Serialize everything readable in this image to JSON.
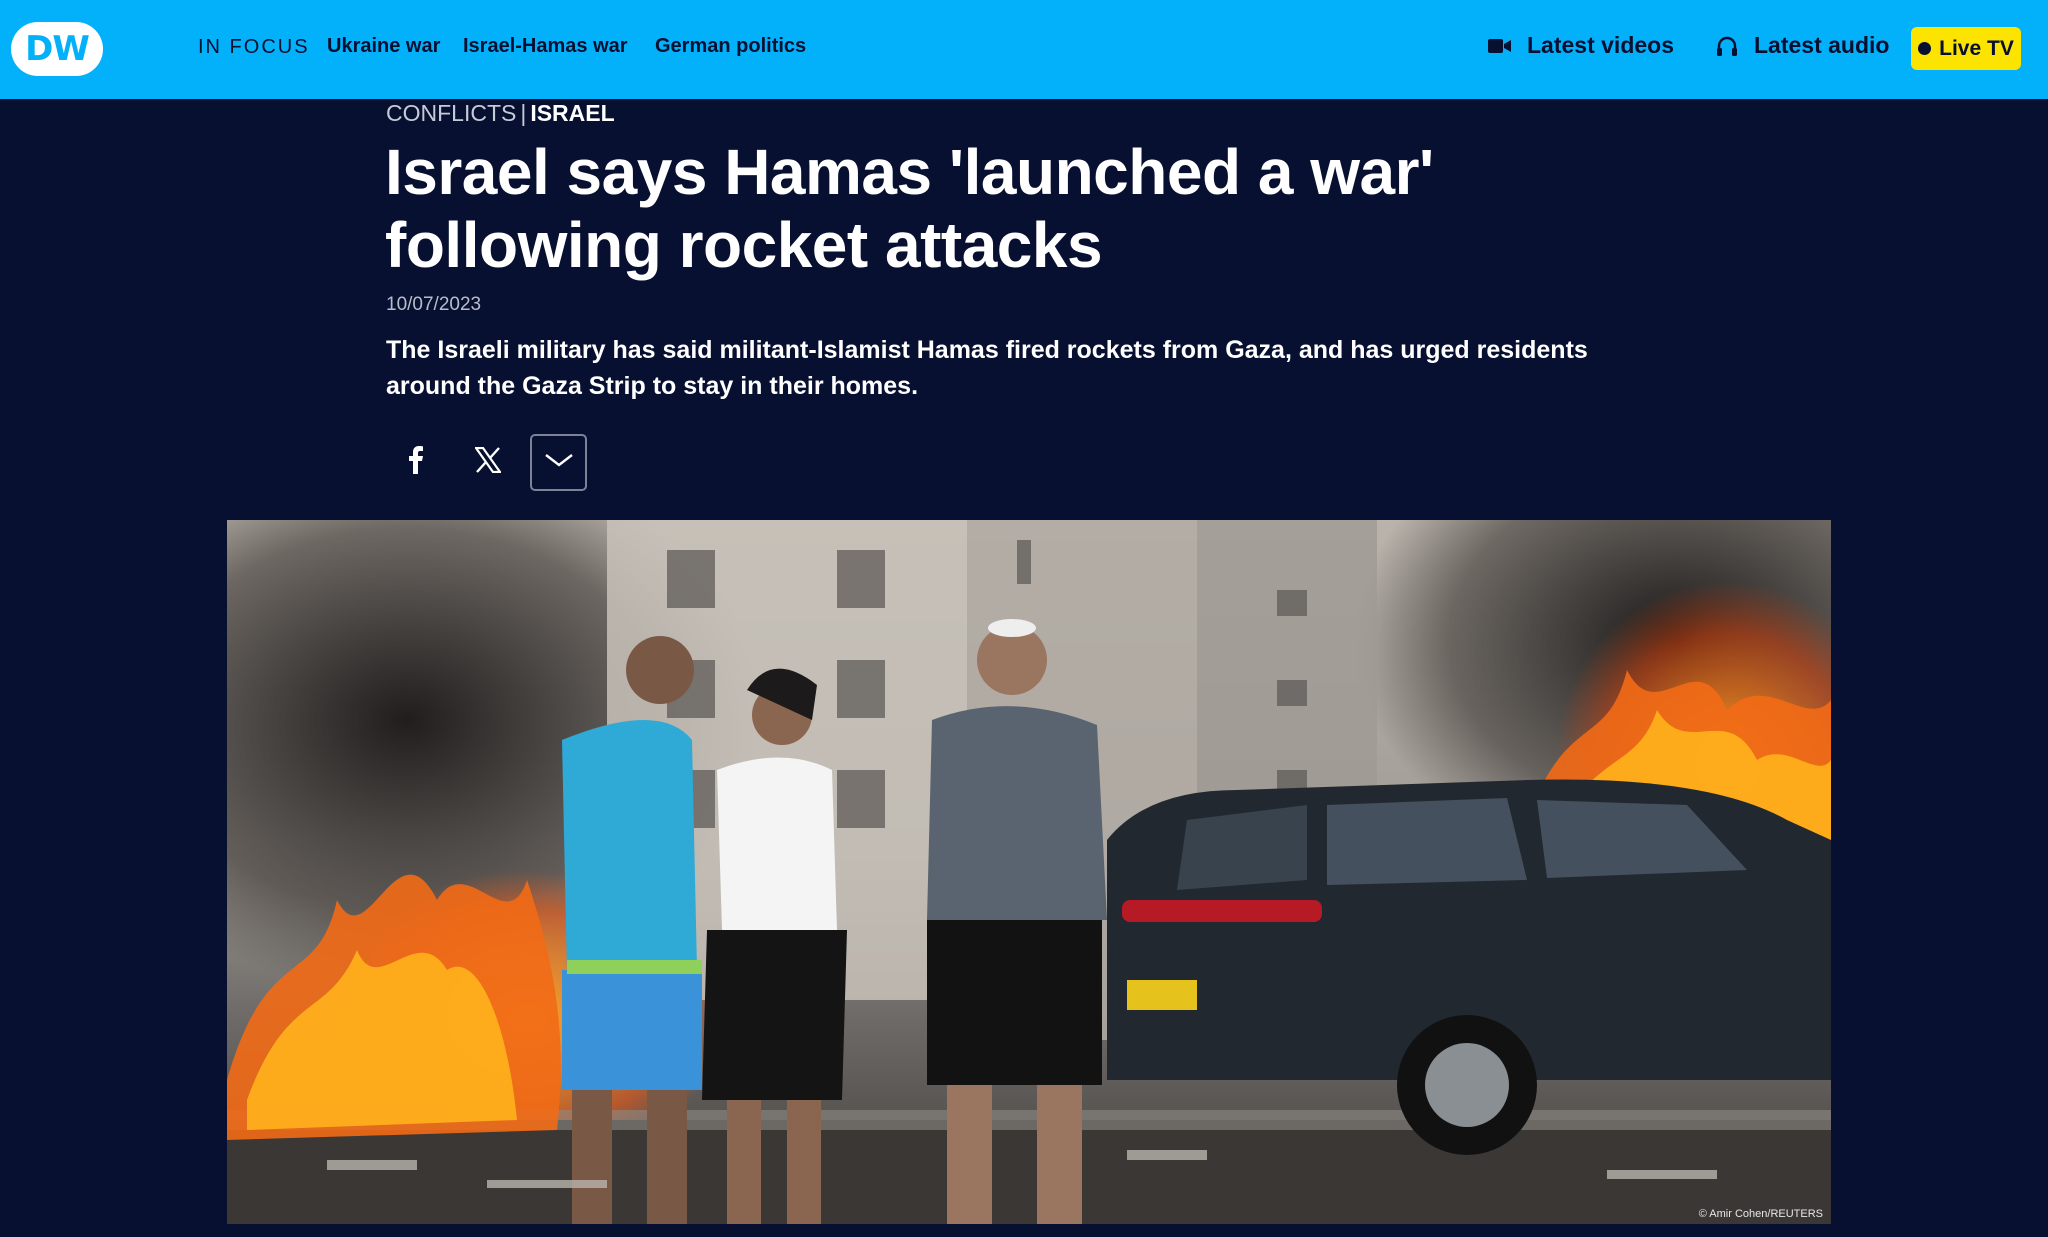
{
  "header": {
    "logo_text": "DW",
    "in_focus_label": "IN FOCUS",
    "focus_links": [
      "Ukraine war",
      "Israel-Hamas war",
      "German politics"
    ],
    "latest_videos": {
      "label": "Latest videos",
      "icon": "video-camera-icon"
    },
    "latest_audio": {
      "label": "Latest audio",
      "icon": "headphones-icon"
    },
    "live_tv": {
      "label": "Live TV",
      "icon": "live-dot-icon"
    }
  },
  "article": {
    "kicker_category": "CONFLICTS",
    "kicker_separator": "|",
    "kicker_topic": "ISRAEL",
    "headline": "Israel says Hamas 'launched a war' following rocket attacks",
    "date": "10/07/2023",
    "teaser": "The Israeli military has said militant-Islamist Hamas fired rockets from Gaza, and has urged residents around the Gaza Strip to stay in their homes.",
    "share": [
      {
        "icon": "facebook-icon"
      },
      {
        "icon": "x-icon"
      },
      {
        "icon": "chevron-down-icon"
      }
    ],
    "image_credit": "© Amir Cohen/REUTERS"
  },
  "colors": {
    "topbar": "#03b1fb",
    "background": "#081031",
    "live_button": "#fde300",
    "text_dark": "#081031"
  }
}
